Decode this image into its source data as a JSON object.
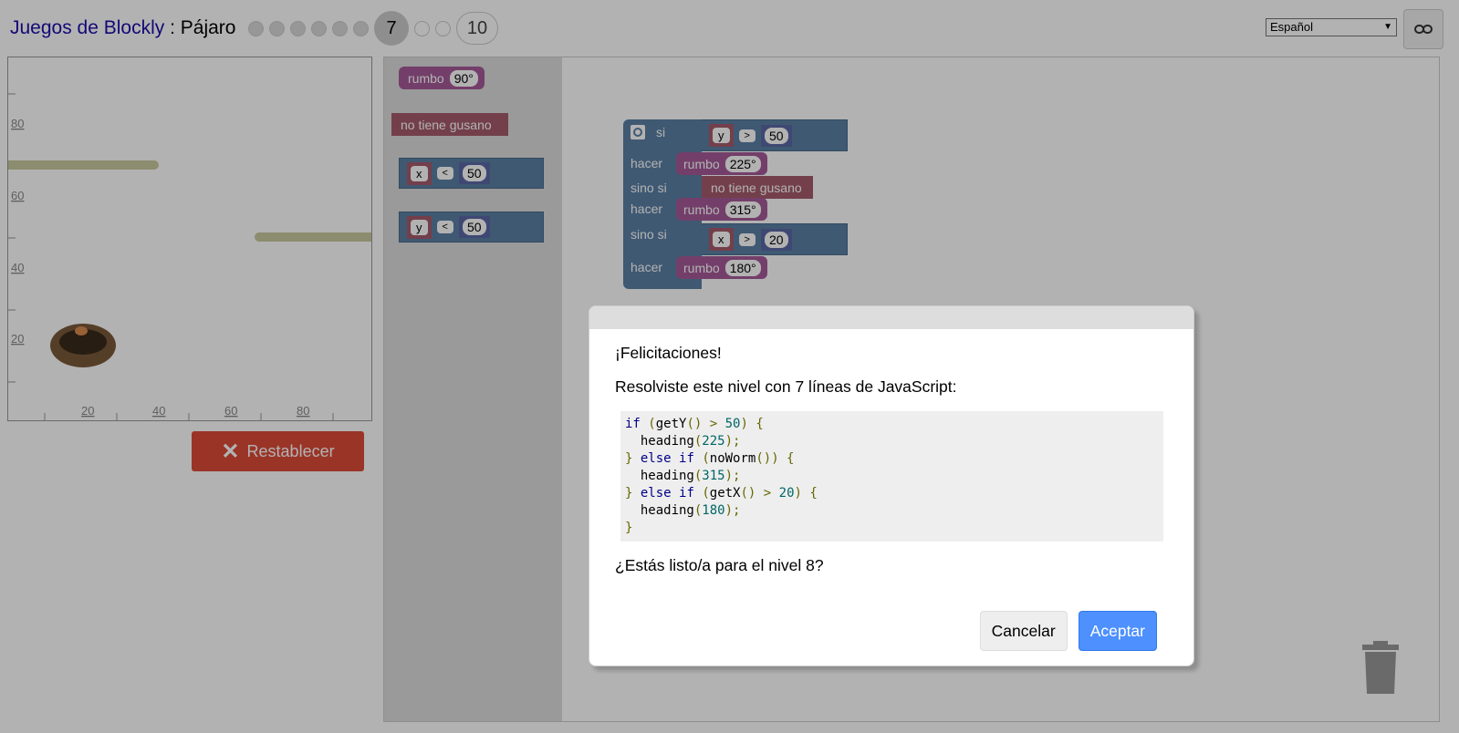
{
  "header": {
    "app_link": "Juegos de Blockly",
    "separator": " : ",
    "game_name": "Pájaro",
    "current_level": "7",
    "last_level": "10",
    "language": "Español"
  },
  "viz": {
    "y_ticks": [
      "80",
      "60",
      "40",
      "20"
    ],
    "x_ticks": [
      "20",
      "40",
      "60",
      "80"
    ]
  },
  "reset_label": "Restablecer",
  "flyout": {
    "heading_label": "rumbo",
    "heading_value": "90°",
    "noworm_label": "no tiene gusano",
    "cmp1_var": "x",
    "cmp1_op": "<",
    "cmp1_num": "50",
    "cmp2_var": "y",
    "cmp2_op": "<",
    "cmp2_num": "50"
  },
  "program": {
    "if_label": "si",
    "do_label": "hacer",
    "elseif_label": "sino si",
    "c1_var": "y",
    "c1_op": ">",
    "c1_num": "50",
    "h1_label": "rumbo",
    "h1_val": "225°",
    "c2_label": "no tiene gusano",
    "h2_label": "rumbo",
    "h2_val": "315°",
    "c3_var": "x",
    "c3_op": ">",
    "c3_num": "20",
    "h3_label": "rumbo",
    "h3_val": "180°"
  },
  "dialog": {
    "congrats": "¡Felicitaciones!",
    "solved": "Resolviste este nivel con 7 líneas de JavaScript:",
    "ready": "¿Estás listo/a para el nivel 8?",
    "cancel": "Cancelar",
    "ok": "Aceptar"
  }
}
